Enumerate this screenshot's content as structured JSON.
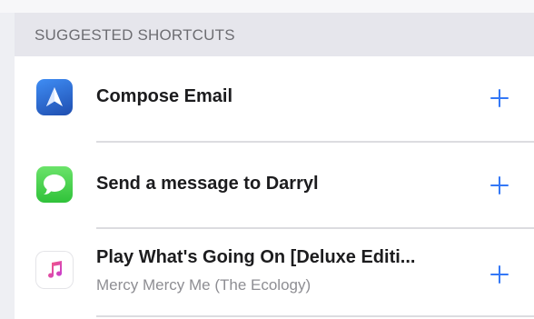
{
  "section": {
    "header": "SUGGESTED SHORTCUTS"
  },
  "shortcuts": [
    {
      "title": "Compose Email",
      "subtitle": "",
      "icon": "spark-mail-icon",
      "action_icon": "plus-icon"
    },
    {
      "title": "Send a message to Darryl",
      "subtitle": "",
      "icon": "messages-icon",
      "action_icon": "plus-icon"
    },
    {
      "title": "Play What's Going On [Deluxe Editi...",
      "subtitle": "Mercy Mercy Me (The Ecology)",
      "icon": "music-note-icon",
      "action_icon": "plus-icon"
    }
  ],
  "colors": {
    "accent": "#3478f6",
    "header_background": "#e6e6ec",
    "background": "#eeeff3"
  }
}
